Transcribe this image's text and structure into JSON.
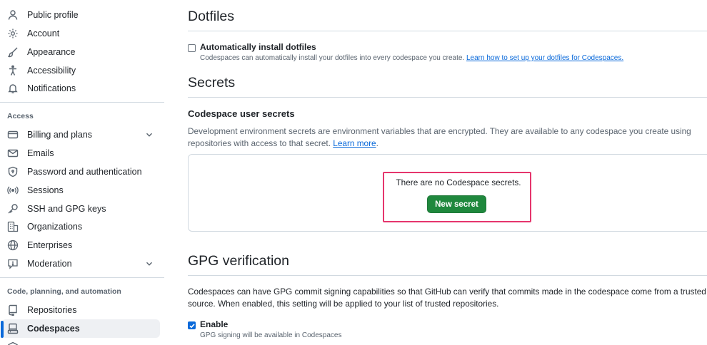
{
  "sidebar": {
    "top_items": [
      {
        "label": "Public profile",
        "icon": "person-icon"
      },
      {
        "label": "Account",
        "icon": "gear-icon"
      },
      {
        "label": "Appearance",
        "icon": "paintbrush-icon"
      },
      {
        "label": "Accessibility",
        "icon": "accessibility-icon"
      },
      {
        "label": "Notifications",
        "icon": "bell-icon"
      }
    ],
    "access_heading": "Access",
    "access_items": [
      {
        "label": "Billing and plans",
        "icon": "credit-card-icon",
        "expandable": true
      },
      {
        "label": "Emails",
        "icon": "mail-icon"
      },
      {
        "label": "Password and authentication",
        "icon": "shield-lock-icon"
      },
      {
        "label": "Sessions",
        "icon": "broadcast-icon"
      },
      {
        "label": "SSH and GPG keys",
        "icon": "key-icon"
      },
      {
        "label": "Organizations",
        "icon": "organization-icon"
      },
      {
        "label": "Enterprises",
        "icon": "globe-icon"
      },
      {
        "label": "Moderation",
        "icon": "report-icon",
        "expandable": true
      }
    ],
    "code_heading": "Code, planning, and automation",
    "code_items": [
      {
        "label": "Repositories",
        "icon": "repo-icon"
      },
      {
        "label": "Codespaces",
        "icon": "codespaces-icon",
        "active": true
      }
    ]
  },
  "dotfiles": {
    "title": "Dotfiles",
    "checkbox_label": "Automatically install dotfiles",
    "checked": false,
    "note": "Codespaces can automatically install your dotfiles into every codespace you create.",
    "link": "Learn how to set up your dotfiles for Codespaces."
  },
  "secrets": {
    "title": "Secrets",
    "subtitle": "Codespace user secrets",
    "description_line1": "Development environment secrets are environment variables that are encrypted. They are available to any codespace you create using",
    "description_line2": "repositories with access to that secret.",
    "learn_more": "Learn more",
    "period": ".",
    "empty_text": "There are no Codespace secrets.",
    "new_button": "New secret"
  },
  "gpg": {
    "title": "GPG verification",
    "description_line1": "Codespaces can have GPG commit signing capabilities so that GitHub can verify that commits made in the codespace come from a trusted",
    "description_line2": "source. When enabled, this setting will be applied to your list of trusted repositories.",
    "checkbox_label": "Enable",
    "checked": true,
    "note": "GPG signing will be available in Codespaces"
  },
  "colors": {
    "accent": "#0969da",
    "button_green": "#1f883d",
    "highlight": "#e5356c",
    "border": "#d1d9e0",
    "muted_text": "#59636e"
  }
}
